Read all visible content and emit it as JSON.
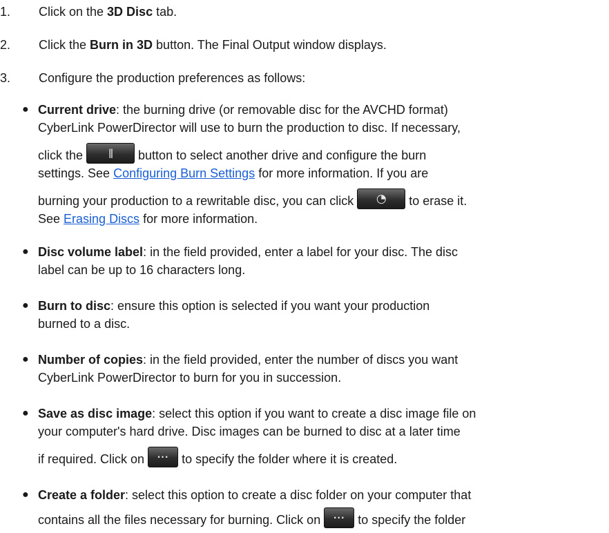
{
  "steps": [
    {
      "num": "1.",
      "pre": "Click on the ",
      "bold": "3D Disc",
      "post": " tab."
    },
    {
      "num": "2.",
      "pre": "Click the ",
      "bold": "Burn in 3D",
      "post": " button. The Final Output window displays."
    },
    {
      "num": "3.",
      "pre": "Configure the production preferences as follows:",
      "bold": "",
      "post": ""
    }
  ],
  "bullets": {
    "current_drive": {
      "term": "Current drive",
      "l1": ": the burning drive (or removable disc for the AVCHD format)",
      "l2": "CyberLink PowerDirector will use to burn the production to disc. If necessary,",
      "l3a": "click the ",
      "l3b": " button to select another drive and configure the burn",
      "l4a": "settings. See ",
      "l4link": "Configuring Burn Settings",
      "l4b": " for more information. If you are",
      "l5a": "burning your production to a rewritable disc, you can click ",
      "l5b": " to erase it.",
      "l6a": "See ",
      "l6link": "Erasing Discs",
      "l6b": " for more information."
    },
    "disc_volume_label": {
      "term": "Disc volume label",
      "l1": ": in the field provided, enter a label for your disc. The disc",
      "l2": "label can be up to 16 characters long."
    },
    "burn_to_disc": {
      "term": "Burn to disc",
      "l1": ": ensure this option is selected if you want your production",
      "l2": "burned to a disc."
    },
    "number_of_copies": {
      "term": "Number of copies",
      "l1": ": in the field provided, enter the number of discs you want",
      "l2": "CyberLink PowerDirector to burn for you in succession."
    },
    "save_as_disc_image": {
      "term": "Save as disc image",
      "l1": ": select this option if you want to create a disc image file on",
      "l2": "your computer's hard drive. Disc images can be burned to disc at a later time",
      "l3a": "if required. Click on ",
      "l3b": " to specify the folder where it is created."
    },
    "create_a_folder": {
      "term": "Create a folder",
      "l1": ": select this option to create a disc folder on your computer that",
      "l2a": "contains all the files necessary for burning. Click on ",
      "l2b": " to specify the folder"
    }
  },
  "icons": {
    "settings": "settings-icon",
    "erase": "erase-disc-icon",
    "browse": "browse-folder-icon"
  },
  "glyphs": {
    "settings": "ǁ",
    "erase": "◔",
    "browse": "···"
  },
  "colors": {
    "link": "#1a5fd6",
    "button": "#2e2e2e"
  }
}
